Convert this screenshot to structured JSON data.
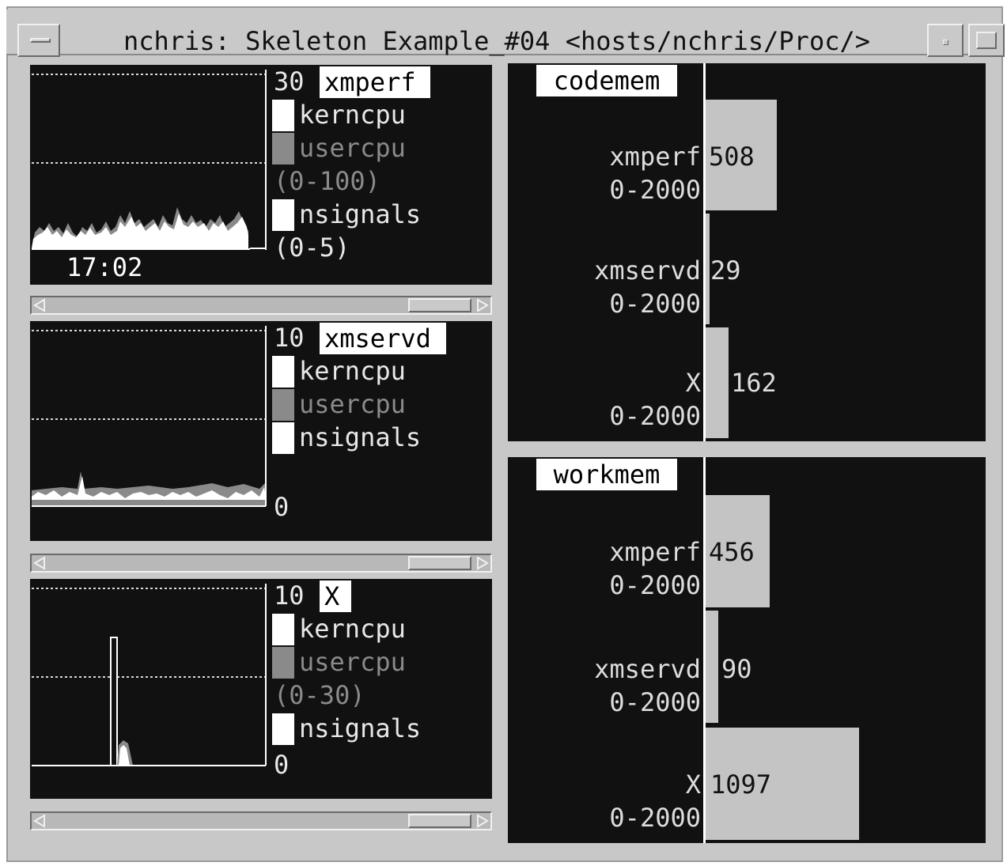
{
  "window": {
    "title": "nchris: Skeleton Example_#04 <hosts/nchris/Proc/>"
  },
  "colors": {
    "panel_bg": "#111111",
    "window_bg": "#c8c8c8",
    "kerncpu": "#ffffff",
    "usercpu": "#8a8a8a",
    "nsignals": "#ffffff",
    "bar": "#c4c4c4"
  },
  "graphs": [
    {
      "name": "xmperf",
      "scale_top": "30",
      "legend": [
        {
          "label": "kerncpu",
          "color": "#ffffff"
        },
        {
          "label": "usercpu",
          "color": "#8a8a8a"
        },
        {
          "label": "(0-100)",
          "color": ""
        },
        {
          "label": "nsignals",
          "color": "#ffffff"
        },
        {
          "label": "(0-5)",
          "color": ""
        }
      ],
      "time": "17:02",
      "baseline": ""
    },
    {
      "name": "xmservd",
      "scale_top": "10",
      "legend": [
        {
          "label": "kerncpu",
          "color": "#ffffff"
        },
        {
          "label": "usercpu",
          "color": "#8a8a8a"
        },
        {
          "label": "nsignals",
          "color": "#ffffff"
        }
      ],
      "time": "",
      "baseline": "0"
    },
    {
      "name": "X",
      "scale_top": "10",
      "legend": [
        {
          "label": "kerncpu",
          "color": "#ffffff"
        },
        {
          "label": "usercpu",
          "color": "#8a8a8a"
        },
        {
          "label": "(0-30)",
          "color": ""
        },
        {
          "label": "nsignals",
          "color": "#ffffff"
        }
      ],
      "time": "",
      "baseline": "0"
    }
  ],
  "bar_panels": [
    {
      "title": "codemem",
      "bars": [
        {
          "label": "xmperf",
          "range": "0-2000",
          "value": 508,
          "value_text": "508"
        },
        {
          "label": "xmservd",
          "range": "0-2000",
          "value": 29,
          "value_text": "29"
        },
        {
          "label": "X",
          "range": "0-2000",
          "value": 162,
          "value_text": "162"
        }
      ]
    },
    {
      "title": "workmem",
      "bars": [
        {
          "label": "xmperf",
          "range": "0-2000",
          "value": 456,
          "value_text": "456"
        },
        {
          "label": "xmservd",
          "range": "0-2000",
          "value": 90,
          "value_text": "90"
        },
        {
          "label": "X",
          "range": "0-2000",
          "value": 1097,
          "value_text": "1097"
        }
      ]
    }
  ]
}
